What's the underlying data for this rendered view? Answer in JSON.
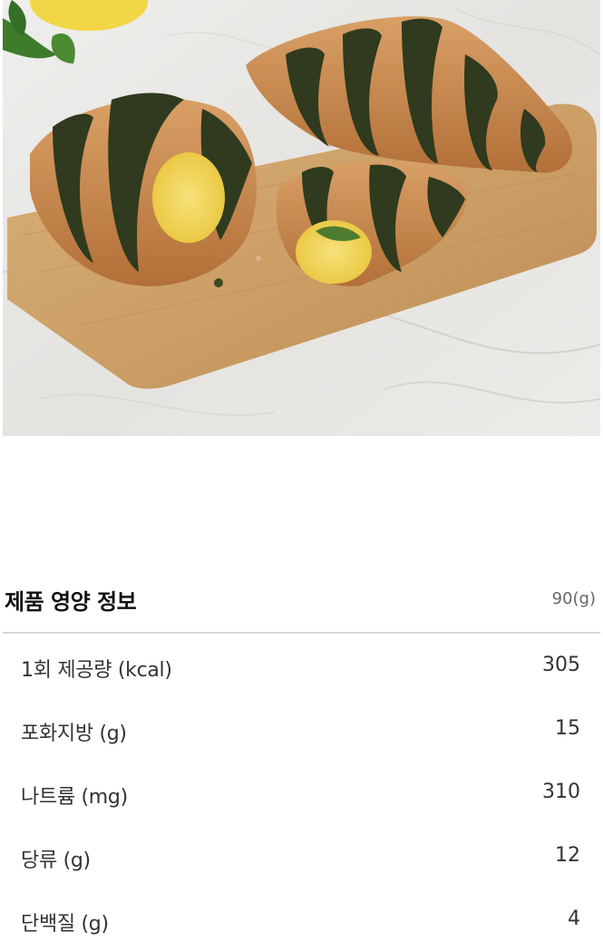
{
  "product_image": {
    "icon": "croissant-photo",
    "colors": {
      "marble": "#e8e7e4",
      "board": "#cfa46e",
      "pastry": "#c98a52",
      "matcha": "#2f3a1e",
      "cream": "#f2d24a",
      "lemon": "#f3d64a",
      "leaf": "#3f7d2c"
    }
  },
  "nutrition": {
    "title": "제품 영양 정보",
    "serving_weight": "90(g)",
    "rows": [
      {
        "label": "1회 제공량 (kcal)",
        "value": "305"
      },
      {
        "label": "포화지방 (g)",
        "value": "15"
      },
      {
        "label": "나트륨 (mg)",
        "value": "310"
      },
      {
        "label": "당류 (g)",
        "value": "12"
      },
      {
        "label": "단백질 (g)",
        "value": "4"
      }
    ]
  }
}
